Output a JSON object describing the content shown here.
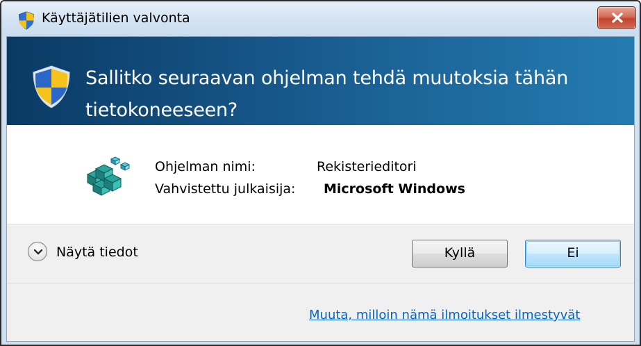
{
  "window": {
    "title": "Käyttäjätilien valvonta",
    "close_icon": "close-icon",
    "close_color": "#c1442c"
  },
  "banner": {
    "question": "Sallitko seuraavan ohjelman tehdä muutoksia tähän tietokoneeseen?",
    "icon": "shield-icon",
    "background": "#1a5f93"
  },
  "program": {
    "icon": "registry-editor-icon",
    "name_label": "Ohjelman nimi:",
    "name_value": "Rekisterieditori",
    "publisher_label": "Vahvistettu julkaisija:",
    "publisher_value": "Microsoft Windows"
  },
  "footer": {
    "details_label": "Näytä tiedot",
    "details_icon": "chevron-down-icon",
    "yes_label": "Kyllä",
    "no_label": "Ei",
    "settings_link": "Muuta, milloin nämä ilmoitukset ilmestyvät",
    "link_color": "#0066cc"
  }
}
